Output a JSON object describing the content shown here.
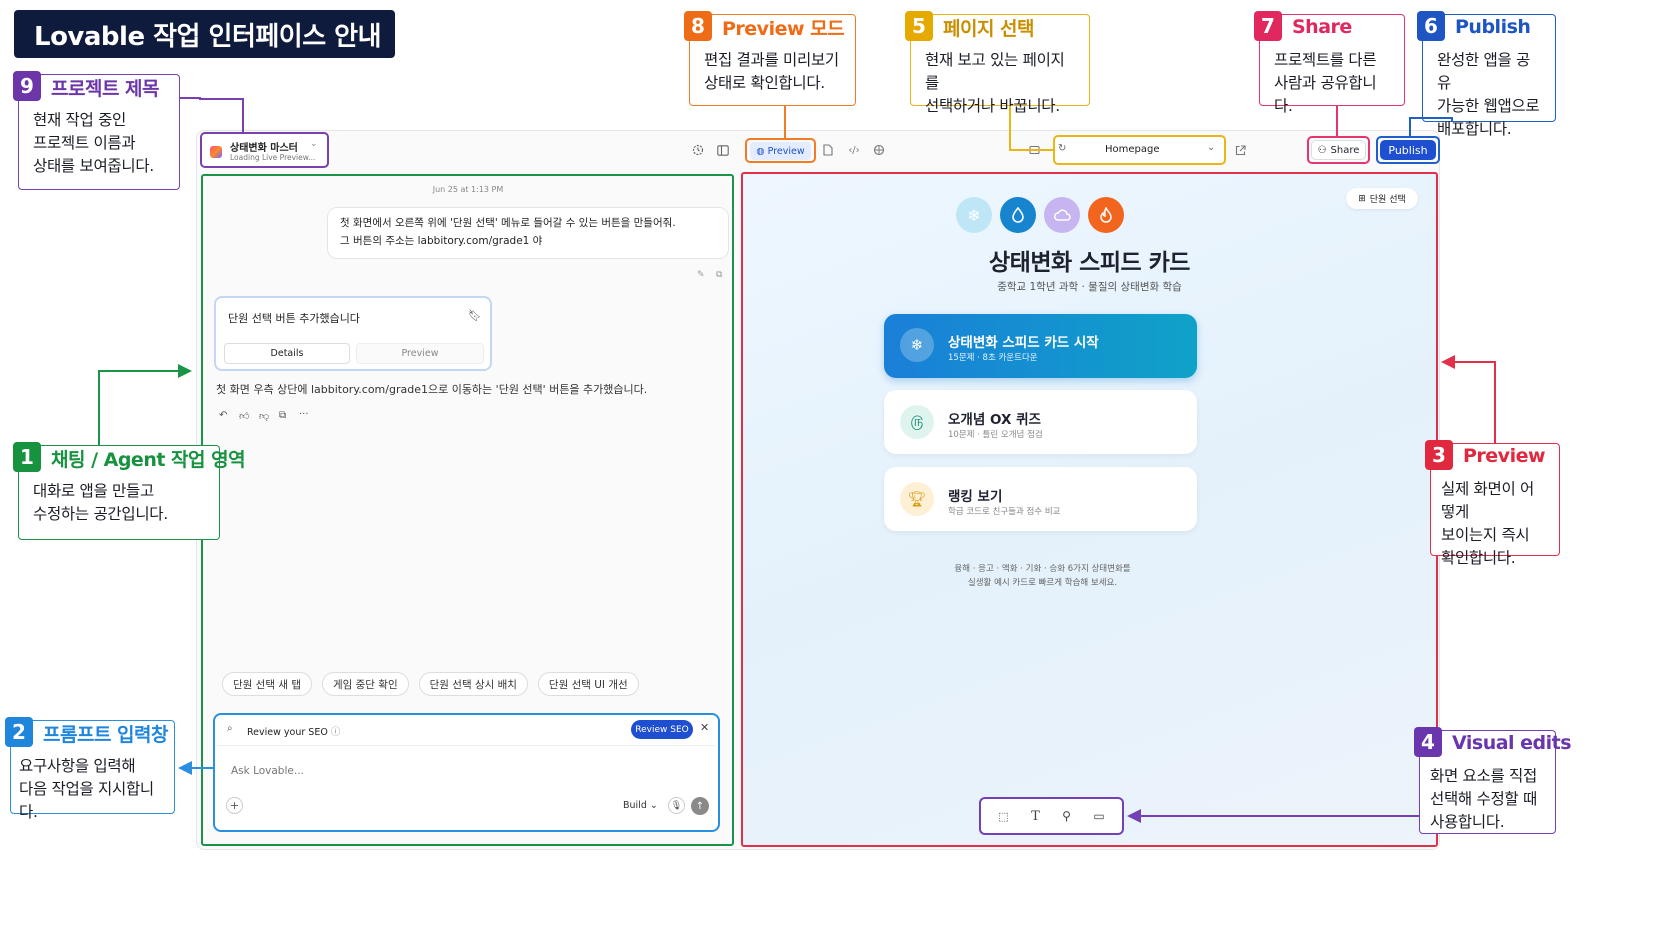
{
  "page_title": "Lovable 작업 인터페이스 안내",
  "callouts": {
    "project_title": {
      "num": "9",
      "title": "프로젝트 제목",
      "desc": "현재 작업 중인\n프로젝트 이름과\n상태를 보여줍니다."
    },
    "preview_mode": {
      "num": "8",
      "title": "Preview 모드",
      "desc": "편집 결과를 미리보기\n상태로 확인합니다."
    },
    "page_select": {
      "num": "5",
      "title": "페이지 선택",
      "desc": "현재 보고 있는 페이지를\n선택하거나 바꿉니다."
    },
    "share": {
      "num": "7",
      "title": "Share",
      "desc": "프로젝트를 다른\n사람과 공유합니다."
    },
    "publish": {
      "num": "6",
      "title": "Publish",
      "desc": "완성한 앱을 공유\n가능한 웹앱으로\n배포합니다."
    },
    "chat_area": {
      "num": "1",
      "title": "채팅 / Agent 작업 영역",
      "desc": "대화로 앱을 만들고\n수정하는 공간입니다."
    },
    "prompt_input": {
      "num": "2",
      "title": "프롬프트 입력창",
      "desc": "요구사항을 입력해\n다음 작업을 지시합니다."
    },
    "preview": {
      "num": "3",
      "title": "Preview",
      "desc": "실제 화면이 어떻게\n보이는지 즉시\n확인합니다."
    },
    "visual_edits": {
      "num": "4",
      "title": "Visual edits",
      "desc": "화면 요소를 직접\n선택해 수정할 때\n사용합니다."
    }
  },
  "topbar": {
    "project_name": "상태변화 마스터",
    "project_status": "Loading Live Preview...",
    "preview_label": "Preview",
    "page_value": "Homepage",
    "share_label": "Share",
    "publish_label": "Publish"
  },
  "chat": {
    "timestamp": "Jun 25 at 1:13 PM",
    "user_message_line1": "첫 화면에서 오른쪽 위에 '단원 선택' 메뉴로 들어갈 수 있는 버튼을 만들어줘.",
    "user_message_line2": "그 버튼의 주소는 labbitory.com/grade1 야",
    "agent_card_title": "단원 선택 버튼 추가했습니다",
    "agent_tab_details": "Details",
    "agent_tab_preview": "Preview",
    "agent_reply": "첫 화면 우측 상단에 labbitory.com/grade1으로 이동하는 '단원 선택' 버튼을 추가했습니다.",
    "suggestions": [
      "단원 선택 새 탭",
      "게임 중단 확인",
      "단원 선택 상시 배치",
      "단원 선택 UI 개선"
    ],
    "seo_label": "Review your SEO",
    "seo_button": "Review SEO",
    "input_placeholder": "Ask Lovable...",
    "build_label": "Build"
  },
  "preview_app": {
    "unit_select": "단원 선택",
    "title": "상태변화 스피드 카드",
    "subtitle": "중학교 1학년 과학 · 물질의 상태변화 학습",
    "cards": [
      {
        "title": "상태변화 스피드 카드 시작",
        "sub": "15문제 · 8초 카운트다운"
      },
      {
        "title": "오개념 OX 퀴즈",
        "sub": "10문제 · 틀린 오개념 점검"
      },
      {
        "title": "랭킹 보기",
        "sub": "학급 코드로 친구들과 점수 비교"
      }
    ],
    "footer_line1": "융해 · 응고 · 액화 · 기화 · 승화 6가지 상태변화를",
    "footer_line2": "실생활 예시 카드로 빠르게 학습해 보세요."
  },
  "colors": {
    "primary_card": "#0f8fd6",
    "publish": "#1f4fd1",
    "chat_border": "#1c9447",
    "preview_border": "#e2304a"
  }
}
